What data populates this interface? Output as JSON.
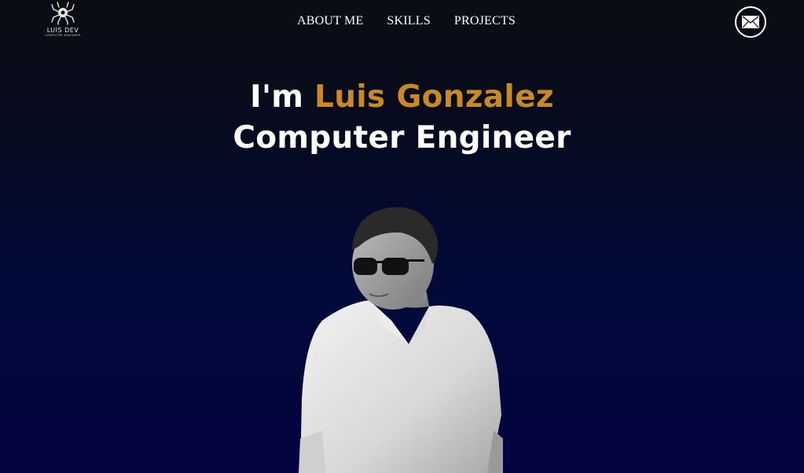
{
  "nav": {
    "logo": {
      "name": "LUIS DEV",
      "subtitle": "COMPUTER ENGINEER",
      "icon": "spider-icon"
    },
    "links": [
      {
        "label": "ABOUT ME"
      },
      {
        "label": "SKILLS"
      },
      {
        "label": "PROJECTS"
      }
    ],
    "contact_icon": "mail-icon"
  },
  "hero": {
    "greeting": "I'm",
    "name": "Luis Gonzalez",
    "role": "Computer Engineer"
  },
  "colors": {
    "accent": "#c98a24",
    "background_top": "#0b0d13",
    "background_bottom": "#04033f",
    "text": "#ffffff"
  }
}
